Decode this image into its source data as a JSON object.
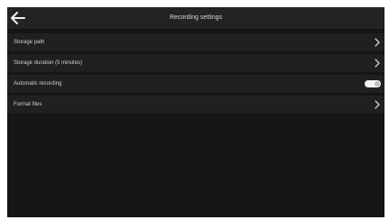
{
  "header": {
    "title": "Recording settings",
    "back_icon": "arrow-left-icon"
  },
  "settings": {
    "items": [
      {
        "label": "Storage path",
        "control": "chevron",
        "icon": "chevron-right-icon"
      },
      {
        "label": "Storage duration (5 minutes)",
        "control": "chevron",
        "icon": "chevron-right-icon"
      },
      {
        "label": "Automatic recording",
        "control": "toggle",
        "toggle_on": true
      },
      {
        "label": "Format files",
        "control": "chevron",
        "icon": "chevron-right-icon"
      }
    ]
  },
  "colors": {
    "background": "#151515",
    "header": "#232323",
    "row": "#202020",
    "text": "#cfcfcf",
    "toggle_track": "#f2f2f2"
  }
}
